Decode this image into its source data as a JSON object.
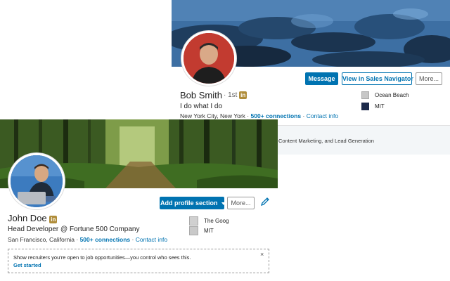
{
  "back_profile": {
    "name": "Bob Smith",
    "degree": "· 1st",
    "badge": "in",
    "headline": "I do what I do",
    "location": "New York City, New York",
    "sep1": "·",
    "connections": "500+ connections",
    "sep2": "·",
    "contact": "Contact info",
    "buttons": {
      "message": "Message",
      "sales_navigator": "View in Sales Navigator",
      "more": "More..."
    },
    "side": [
      {
        "label": "Ocean Beach"
      },
      {
        "label": "MIT"
      }
    ],
    "strip_text": "Content Marketing, and Lead Generation"
  },
  "front_profile": {
    "name": "John Doe",
    "badge": "in",
    "headline": "Head Developer @ Fortune 500 Company",
    "location": "San Francisco, California",
    "sep1": "·",
    "connections": "500+ connections",
    "sep2": "·",
    "contact": "Contact info",
    "buttons": {
      "add_section": "Add profile section",
      "more": "More..."
    },
    "side": [
      {
        "label": "The Goog"
      },
      {
        "label": "MIT"
      }
    ],
    "notice": {
      "text": "Show recruiters you're open to job opportunities—you control who sees this.",
      "link": "Get started",
      "close": "×"
    }
  },
  "colors": {
    "accent": "#0073b1",
    "badge": "#b08d3a"
  }
}
